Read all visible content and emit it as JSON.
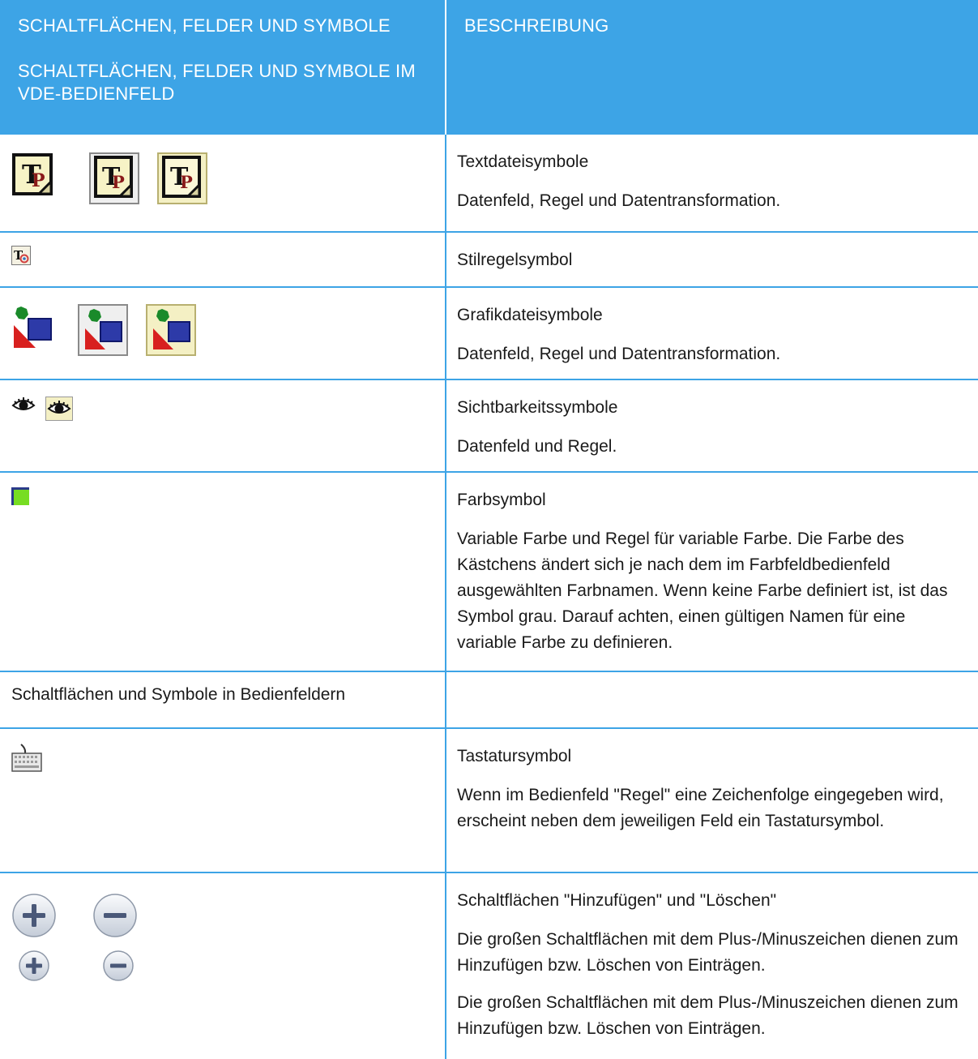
{
  "header": {
    "col1_line1": "SCHALTFLÄCHEN, FELDER UND SYMBOLE",
    "col1_line2": "SCHALTFLÄCHEN, FELDER UND SYMBOLE IM VDE-BEDIENFELD",
    "col2": "BESCHREIBUNG"
  },
  "rows": {
    "text": {
      "icons": [
        "text-file-icon",
        "text-file-framed-icon",
        "text-file-highlighted-icon"
      ],
      "title": "Textdateisymbole",
      "desc": "Datenfeld, Regel und Datentransformation."
    },
    "style": {
      "icons": [
        "style-rule-icon"
      ],
      "title": "Stilregelsymbol"
    },
    "graphic": {
      "icons": [
        "graphic-file-icon",
        "graphic-file-framed-icon",
        "graphic-file-highlighted-icon"
      ],
      "title": "Grafikdateisymbole",
      "desc": "Datenfeld, Regel und Datentransformation."
    },
    "visibility": {
      "icons": [
        "eye-icon",
        "eye-framed-icon"
      ],
      "title": "Sichtbarkeitssymbole",
      "desc": "Datenfeld und Regel."
    },
    "color": {
      "icons": [
        "color-swatch-icon"
      ],
      "swatch_color": "#77dd22",
      "title": "Farbsymbol",
      "desc": "Variable Farbe und Regel für variable Farbe. Die Farbe des Kästchens ändert sich je nach dem im Farbfeldbedienfeld ausgewählten Farbnamen. Wenn keine Farbe definiert ist, ist das Symbol grau. Darauf achten, einen gültigen Namen für eine variable Farbe zu definieren."
    },
    "section": {
      "label": "Schaltflächen und Symbole in Bedienfeldern"
    },
    "keyboard": {
      "icons": [
        "keyboard-icon"
      ],
      "title": "Tastatursymbol",
      "desc": "Wenn im Bedienfeld \"Regel\" eine Zeichenfolge eingegeben wird, erscheint neben dem jeweiligen Feld ein Tastatursymbol."
    },
    "addremove": {
      "icons": [
        "plus-large-icon",
        "minus-large-icon",
        "plus-small-icon",
        "minus-small-icon"
      ],
      "title": "Schaltflächen \"Hinzufügen\" und \"Löschen\"",
      "desc1": "Die großen Schaltflächen mit dem Plus-/Minuszeichen dienen zum Hinzufügen bzw. Löschen von Einträgen.",
      "desc2": "Die großen Schaltflächen mit dem Plus-/Minuszeichen dienen zum Hinzufügen bzw. Löschen von Einträgen."
    }
  },
  "colors": {
    "header_bg": "#3da4e6",
    "border": "#3da4e6"
  }
}
